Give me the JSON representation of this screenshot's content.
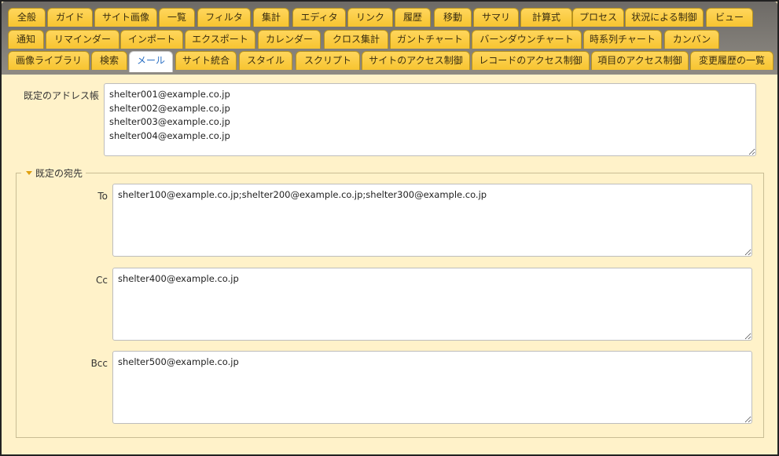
{
  "tabs": {
    "row1": [
      "全般",
      "ガイド",
      "サイト画像",
      "一覧",
      "フィルタ",
      "集計",
      "エディタ",
      "リンク",
      "履歴",
      "移動",
      "サマリ",
      "計算式",
      "プロセス",
      "状況による制御",
      "ビュー"
    ],
    "row2": [
      "通知",
      "リマインダー",
      "インポート",
      "エクスポート",
      "カレンダー",
      "クロス集計",
      "ガントチャート",
      "バーンダウンチャート",
      "時系列チャート",
      "カンバン"
    ],
    "row3": [
      "画像ライブラリ",
      "検索",
      "メール",
      "サイト統合",
      "スタイル",
      "スクリプト",
      "サイトのアクセス制御",
      "レコードのアクセス制御",
      "項目のアクセス制御",
      "変更履歴の一覧"
    ],
    "active": "メール"
  },
  "mail": {
    "address_book_label": "既定のアドレス帳",
    "address_book_value": "shelter001@example.co.jp\nshelter002@example.co.jp\nshelter003@example.co.jp\nshelter004@example.co.jp",
    "default_destination_legend": "既定の宛先",
    "to_label": "To",
    "to_value": "shelter100@example.co.jp;shelter200@example.co.jp;shelter300@example.co.jp",
    "cc_label": "Cc",
    "cc_value": "shelter400@example.co.jp",
    "bcc_label": "Bcc",
    "bcc_value": "shelter500@example.co.jp"
  }
}
